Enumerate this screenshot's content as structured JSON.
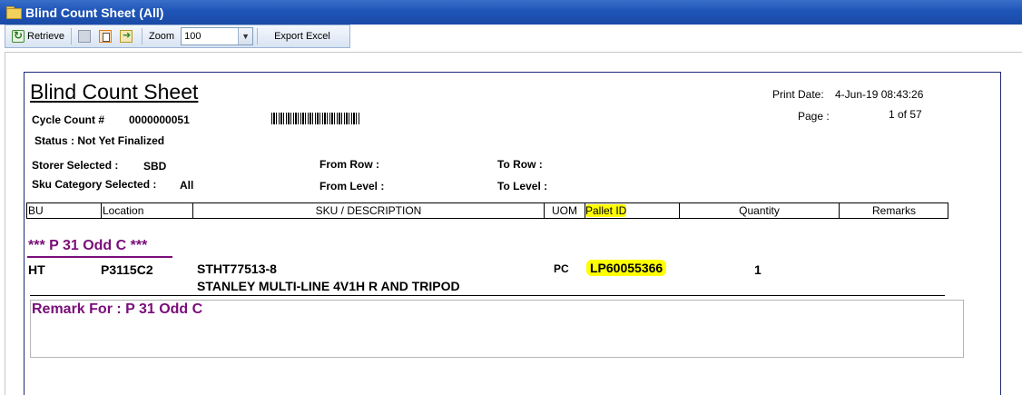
{
  "window": {
    "title": "Blind Count Sheet (All)"
  },
  "toolbar": {
    "retrieve_label": "Retrieve",
    "zoom_label": "Zoom",
    "zoom_value": "100",
    "export_label": "Export Excel"
  },
  "report": {
    "title": "Blind Count Sheet",
    "print_date_label": "Print Date:",
    "print_date_value": "4-Jun-19 08:43:26",
    "page_label": "Page :",
    "page_value": "1 of 57",
    "cycle_count_label": "Cycle Count #",
    "cycle_count_value": "0000000051",
    "status_text": "Status : Not Yet Finalized",
    "storer_label": "Storer Selected :",
    "storer_value": "SBD",
    "sku_cat_label": "Sku Category Selected :",
    "sku_cat_value": "All",
    "from_row_label": "From Row :",
    "from_level_label": "From Level :",
    "to_row_label": "To Row :",
    "to_level_label": "To Level :"
  },
  "table": {
    "headers": [
      "BU",
      "Location",
      "SKU / DESCRIPTION",
      "UOM",
      "Pallet ID",
      "Quantity",
      "Remarks"
    ]
  },
  "group": {
    "title": "*** P 31 Odd C ***",
    "rows": [
      {
        "bu": "HT",
        "location": "P3115C2",
        "sku": "STHT77513-8",
        "description": "STANLEY MULTI-LINE 4V1H R AND TRIPOD",
        "uom": "PC",
        "pallet_id": "LP60055366",
        "quantity": "1"
      }
    ],
    "remark_title": "Remark For : P 31 Odd C"
  },
  "colors": {
    "titlebar": "#1f55b8",
    "group_text": "#7a0d7a",
    "highlight": "#ffff00"
  }
}
